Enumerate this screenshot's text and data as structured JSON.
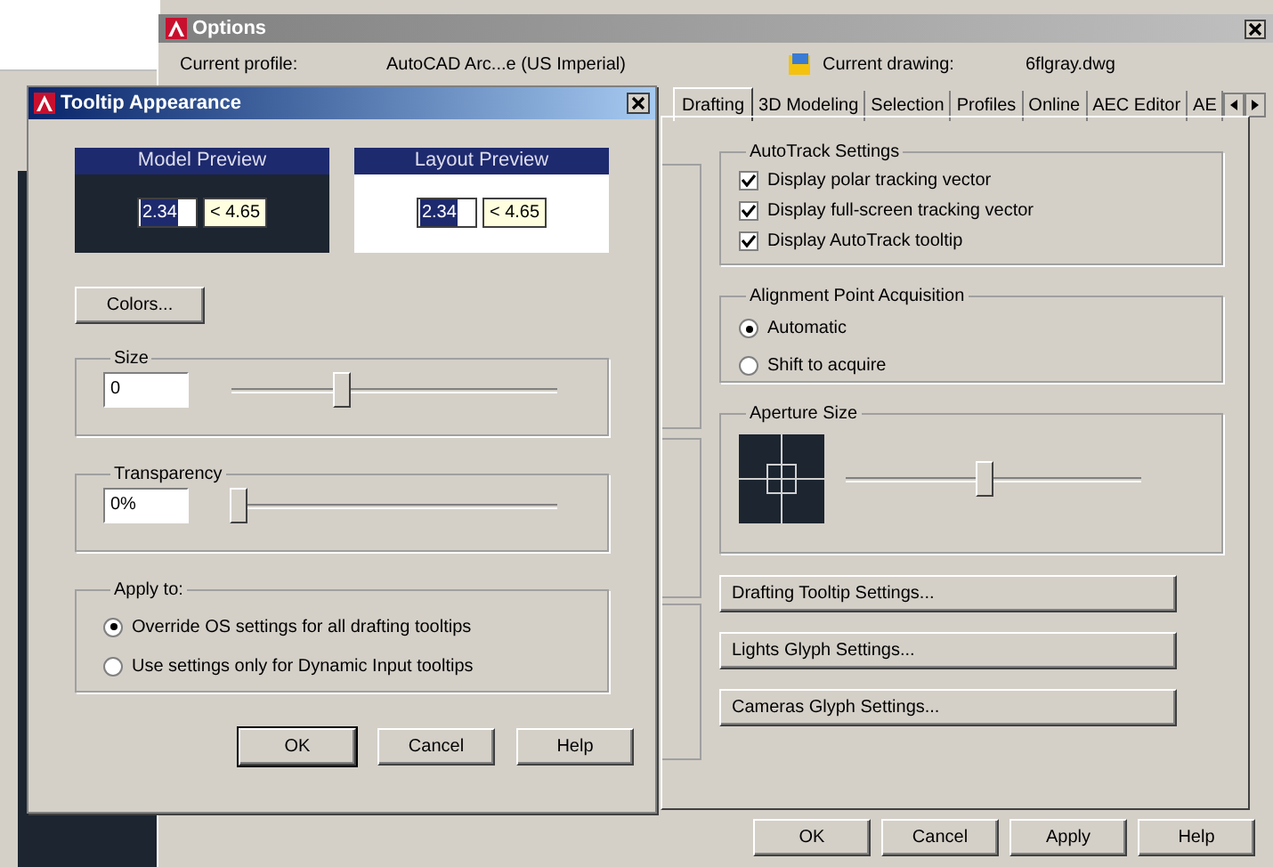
{
  "options_window": {
    "title": "Options",
    "current_profile_label": "Current profile:",
    "current_profile": "AutoCAD Arc...e (US Imperial)",
    "current_drawing_label": "Current drawing:",
    "current_drawing": "6flgray.dwg",
    "tabs": [
      {
        "label": "Drafting",
        "selected": true
      },
      {
        "label": "3D Modeling",
        "selected": false
      },
      {
        "label": "Selection",
        "selected": false
      },
      {
        "label": "Profiles",
        "selected": false
      },
      {
        "label": "Online",
        "selected": false
      },
      {
        "label": "AEC Editor",
        "selected": false
      },
      {
        "label": "AE",
        "selected": false
      }
    ],
    "autotrack": {
      "title": "AutoTrack Settings",
      "options": [
        {
          "label": "Display polar tracking vector",
          "checked": true
        },
        {
          "label": "Display full-screen tracking vector",
          "checked": true
        },
        {
          "label": "Display AutoTrack tooltip",
          "checked": true
        }
      ]
    },
    "alignment": {
      "title": "Alignment Point Acquisition",
      "options": [
        {
          "label": "Automatic",
          "selected": true
        },
        {
          "label": "Shift to acquire",
          "selected": false
        }
      ]
    },
    "aperture": {
      "title": "Aperture Size",
      "level": 0.47
    },
    "settings_buttons": [
      "Drafting Tooltip Settings...",
      "Lights Glyph Settings...",
      "Cameras Glyph Settings..."
    ],
    "buttons": [
      "OK",
      "Cancel",
      "Apply",
      "Help"
    ]
  },
  "tooltip_dialog": {
    "title": "Tooltip Appearance",
    "previews": [
      {
        "title": "Model Preview",
        "kind": "dark",
        "value": "2.34",
        "angle": "< 4.65"
      },
      {
        "title": "Layout Preview",
        "kind": "light",
        "value": "2.34",
        "angle": "< 4.65"
      }
    ],
    "colors_button": "Colors...",
    "size": {
      "title": "Size",
      "value": "0",
      "level": 0.34
    },
    "transparency": {
      "title": "Transparency",
      "value": "0%",
      "level": 0.02
    },
    "apply_to": {
      "title": "Apply to:",
      "options": [
        {
          "label": "Override OS settings for all drafting tooltips",
          "selected": true
        },
        {
          "label": "Use settings only for Dynamic Input tooltips",
          "selected": false
        }
      ]
    },
    "buttons": [
      "OK",
      "Cancel",
      "Help"
    ]
  }
}
